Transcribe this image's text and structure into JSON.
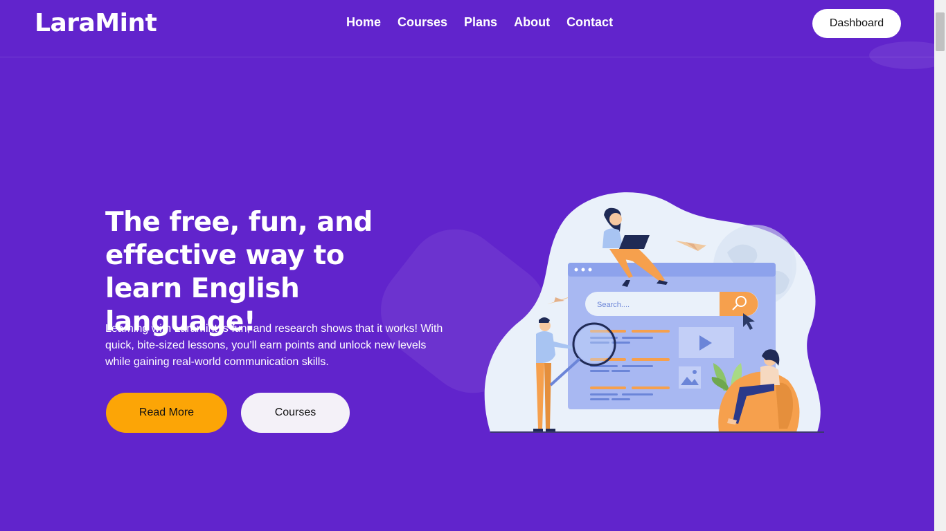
{
  "header": {
    "logo": "LaraMint",
    "nav": [
      "Home",
      "Courses",
      "Plans",
      "About",
      "Contact"
    ],
    "dashboard_label": "Dashboard"
  },
  "hero": {
    "title": "The free, fun, and effective way to learn English language!",
    "description": "Learning with Laramint is fun, and research shows that it works! With quick, bite-sized lessons, you’ll earn points and unlock new levels while gaining real-world communication skills.",
    "read_more_label": "Read More",
    "courses_label": "Courses"
  },
  "illustration": {
    "search_placeholder": "Search....",
    "icons": [
      "search-icon",
      "play-icon",
      "image-icon",
      "cursor-icon",
      "paper-plane-icon",
      "globe-icon",
      "laptop-icon"
    ]
  },
  "colors": {
    "background": "#6124cc",
    "accent": "#fca506",
    "button_light": "#f4f1f8",
    "illustration_blob": "#eaf1fa",
    "window": "#a8b8f2",
    "orange": "#f6a04d"
  }
}
